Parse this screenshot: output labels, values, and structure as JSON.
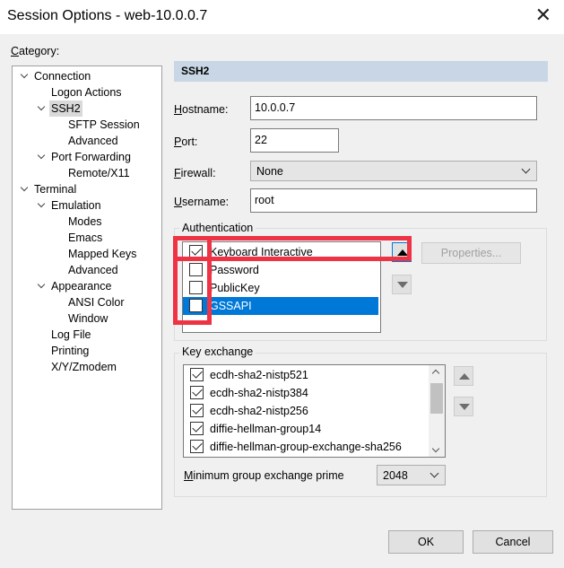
{
  "window": {
    "title": "Session Options - web-10.0.0.7",
    "close_glyph": "✕"
  },
  "category": {
    "label": "Category:",
    "tree": [
      {
        "label": "Connection",
        "expanded": true
      },
      {
        "label": "Logon Actions"
      },
      {
        "label": "SSH2",
        "expanded": true,
        "selected": true
      },
      {
        "label": "SFTP Session"
      },
      {
        "label": "Advanced"
      },
      {
        "label": "Port Forwarding",
        "expanded": true
      },
      {
        "label": "Remote/X11"
      },
      {
        "label": "Terminal",
        "expanded": true
      },
      {
        "label": "Emulation",
        "expanded": true
      },
      {
        "label": "Modes"
      },
      {
        "label": "Emacs"
      },
      {
        "label": "Mapped Keys"
      },
      {
        "label": "Advanced"
      },
      {
        "label": "Appearance",
        "expanded": true
      },
      {
        "label": "ANSI Color"
      },
      {
        "label": "Window"
      },
      {
        "label": "Log File"
      },
      {
        "label": "Printing"
      },
      {
        "label": "X/Y/Zmodem"
      }
    ]
  },
  "ssh2": {
    "header": "SSH2",
    "hostname_label": "Hostname:",
    "hostname_value": "10.0.0.7",
    "port_label": "Port:",
    "port_value": "22",
    "firewall_label": "Firewall:",
    "firewall_value": "None",
    "username_label": "Username:",
    "username_value": "root"
  },
  "authentication": {
    "title": "Authentication",
    "methods": [
      {
        "label": "Keyboard Interactive",
        "checked": true,
        "selected": false
      },
      {
        "label": "Password",
        "checked": false,
        "selected": false
      },
      {
        "label": "PublicKey",
        "checked": false,
        "selected": false
      },
      {
        "label": "GSSAPI",
        "checked": false,
        "selected": true
      }
    ],
    "properties_button": "Properties..."
  },
  "key_exchange": {
    "title": "Key exchange",
    "items": [
      {
        "label": "ecdh-sha2-nistp521",
        "checked": true
      },
      {
        "label": "ecdh-sha2-nistp384",
        "checked": true
      },
      {
        "label": "ecdh-sha2-nistp256",
        "checked": true
      },
      {
        "label": "diffie-hellman-group14",
        "checked": true
      },
      {
        "label": "diffie-hellman-group-exchange-sha256",
        "checked": true
      }
    ],
    "min_group_label": "Minimum group exchange prime",
    "min_group_value": "2048"
  },
  "buttons": {
    "ok": "OK",
    "cancel": "Cancel"
  },
  "colors": {
    "highlight": "#0078d7",
    "annotation_red": "#ee3344",
    "section_header": "#c8d6e5"
  }
}
